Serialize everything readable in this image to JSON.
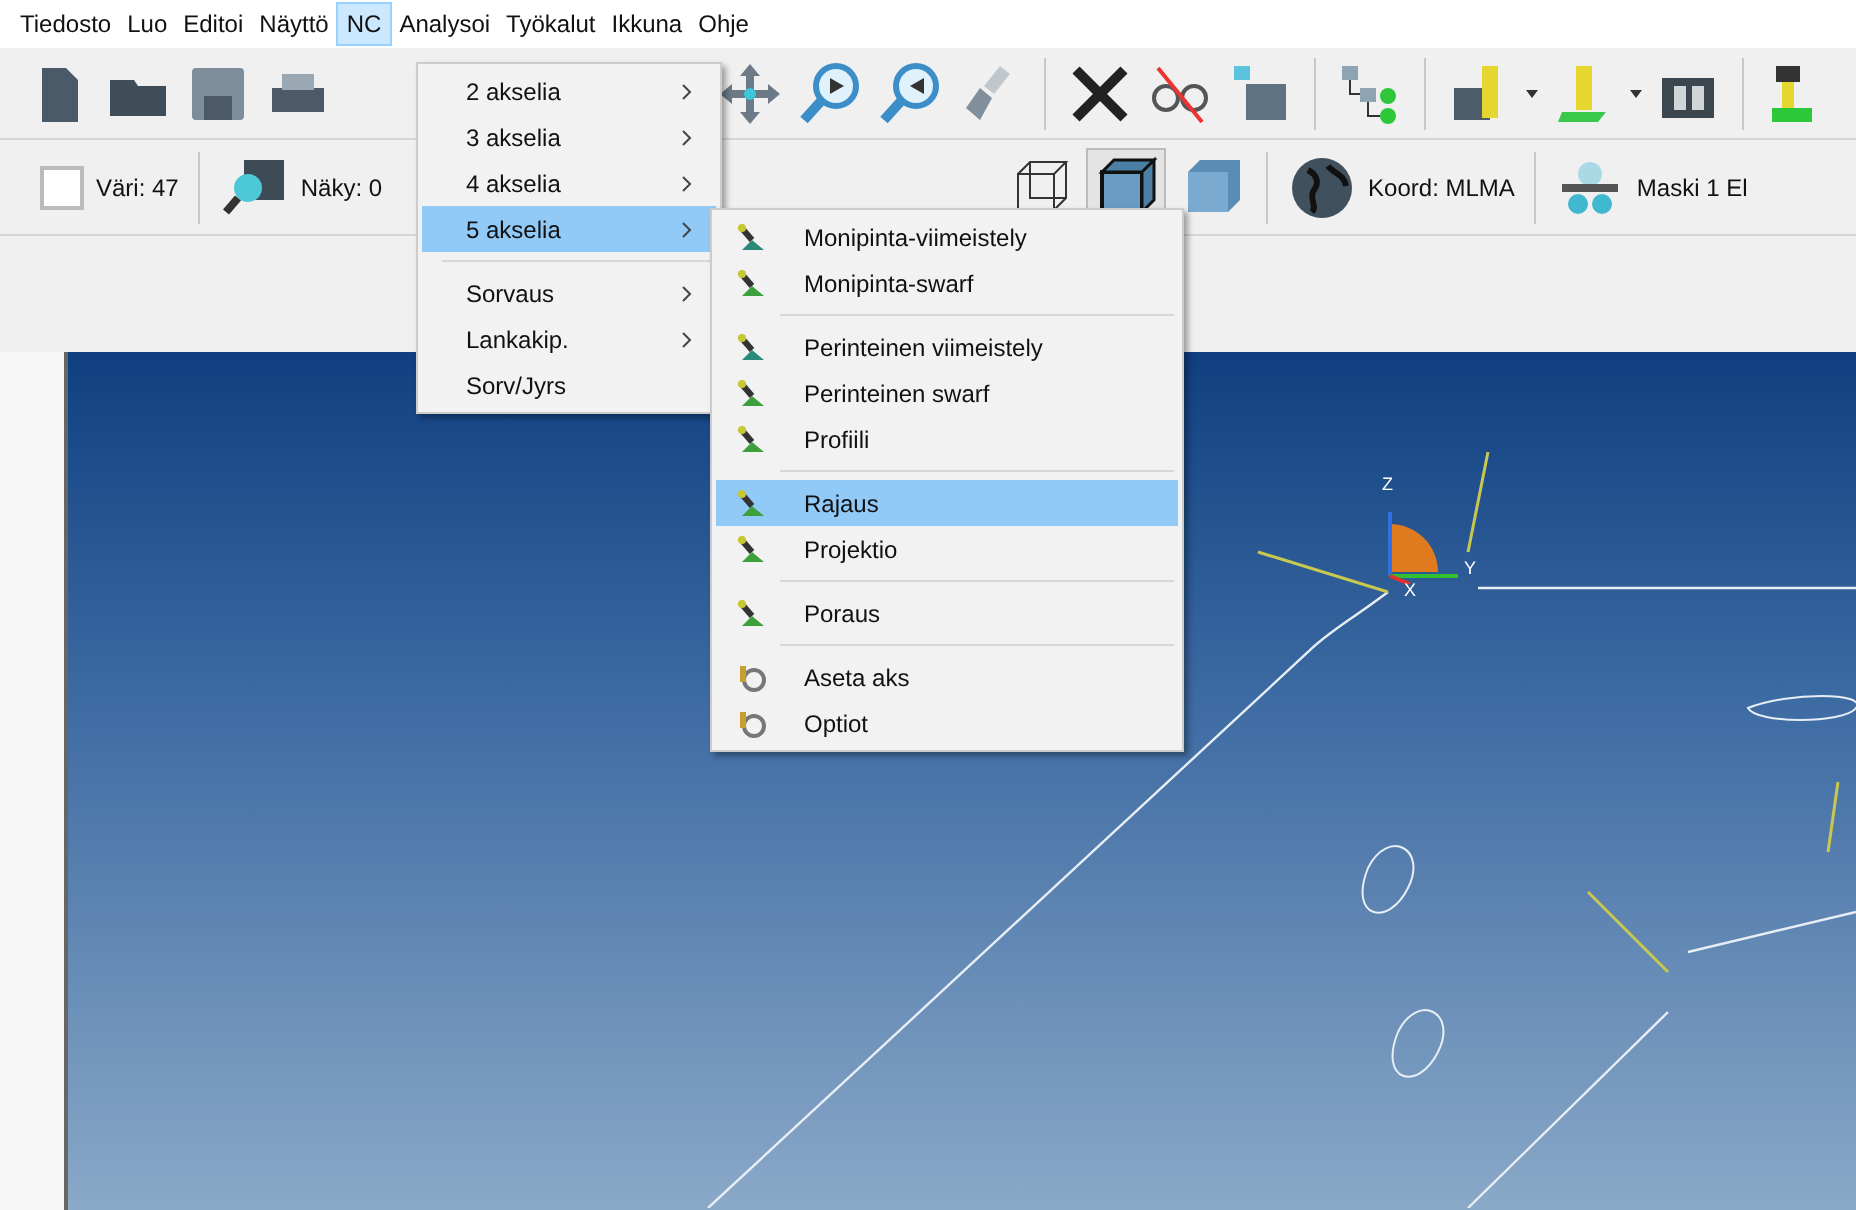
{
  "menubar": [
    {
      "label": "Tiedosto",
      "selected": false
    },
    {
      "label": "Luo",
      "selected": false
    },
    {
      "label": "Editoi",
      "selected": false
    },
    {
      "label": "Näyttö",
      "selected": false
    },
    {
      "label": "NC",
      "selected": true
    },
    {
      "label": "Analysoi",
      "selected": false
    },
    {
      "label": "Työkalut",
      "selected": false
    },
    {
      "label": "Ikkuna",
      "selected": false
    },
    {
      "label": "Ohje",
      "selected": false
    }
  ],
  "toolbar2": {
    "color_label": "Väri: 47",
    "visibility_label": "Näky: 0",
    "coord_label": "Koord: MLMA",
    "mask_label": "Maski 1 El"
  },
  "nc_menu": {
    "groups": [
      [
        {
          "label": "2 akselia",
          "selected": false,
          "submenu": true
        },
        {
          "label": "3 akselia",
          "selected": false,
          "submenu": true
        },
        {
          "label": "4 akselia",
          "selected": false,
          "submenu": true
        },
        {
          "label": "5 akselia",
          "selected": true,
          "submenu": true
        }
      ],
      [
        {
          "label": "Sorvaus",
          "selected": false,
          "submenu": true
        },
        {
          "label": "Lankakip.",
          "selected": false,
          "submenu": true
        },
        {
          "label": "Sorv/Jyrs",
          "selected": false,
          "submenu": false
        }
      ]
    ]
  },
  "submenu": {
    "groups": [
      [
        {
          "label": "Monipinta-viimeistely",
          "selected": false
        },
        {
          "label": "Monipinta-swarf",
          "selected": false
        }
      ],
      [
        {
          "label": "Perinteinen viimeistely",
          "selected": false
        },
        {
          "label": "Perinteinen swarf",
          "selected": false
        },
        {
          "label": "Profiili",
          "selected": false
        }
      ],
      [
        {
          "label": "Rajaus",
          "selected": true
        },
        {
          "label": "Projektio",
          "selected": false
        }
      ],
      [
        {
          "label": "Poraus",
          "selected": false
        }
      ],
      [
        {
          "label": "Aseta aks",
          "selected": false
        },
        {
          "label": "Optiot",
          "selected": false
        }
      ]
    ]
  },
  "viewport": {
    "axes": [
      "Z",
      "Y",
      "X"
    ]
  }
}
